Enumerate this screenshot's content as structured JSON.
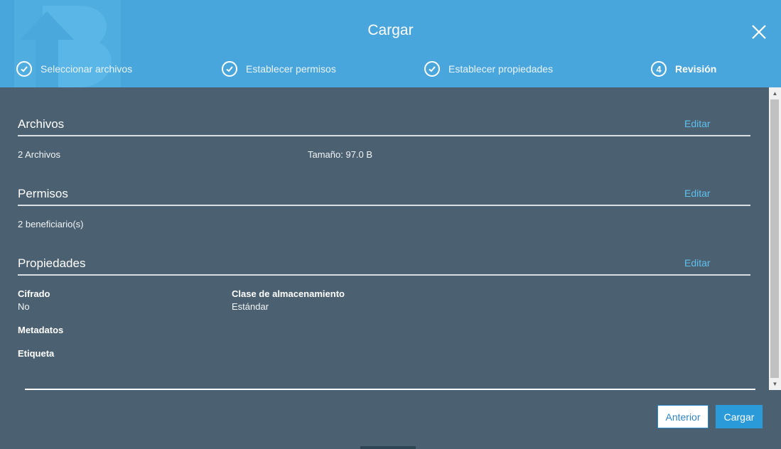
{
  "dialog": {
    "title": "Cargar",
    "close_icon": "close-icon"
  },
  "steps": [
    {
      "label": "Seleccionar archivos",
      "state": "done",
      "icon": "check-circle-icon"
    },
    {
      "label": "Establecer permisos",
      "state": "done",
      "icon": "check-circle-icon"
    },
    {
      "label": "Establecer propiedades",
      "state": "done",
      "icon": "check-circle-icon"
    },
    {
      "label": "Revisión",
      "state": "active",
      "number": "4"
    }
  ],
  "sections": {
    "files": {
      "title": "Archivos",
      "edit": "Editar",
      "count": "2 Archivos",
      "size": "Tamaño: 97.0 B"
    },
    "permissions": {
      "title": "Permisos",
      "edit": "Editar",
      "grantees": "2 beneficiario(s)"
    },
    "properties": {
      "title": "Propiedades",
      "edit": "Editar",
      "encryption_label": "Cifrado",
      "encryption_value": "No",
      "storage_label": "Clase de almacenamiento",
      "storage_value": "Estándar",
      "metadata_label": "Metadatos",
      "tag_label": "Etiqueta"
    }
  },
  "footer": {
    "prev_button": "Anterior",
    "upload_button": "Cargar"
  },
  "colors": {
    "header_bg": "#49a6dc",
    "body_bg": "#4b6070",
    "link": "#5fc0ee",
    "primary_button": "#2a9ad8"
  }
}
